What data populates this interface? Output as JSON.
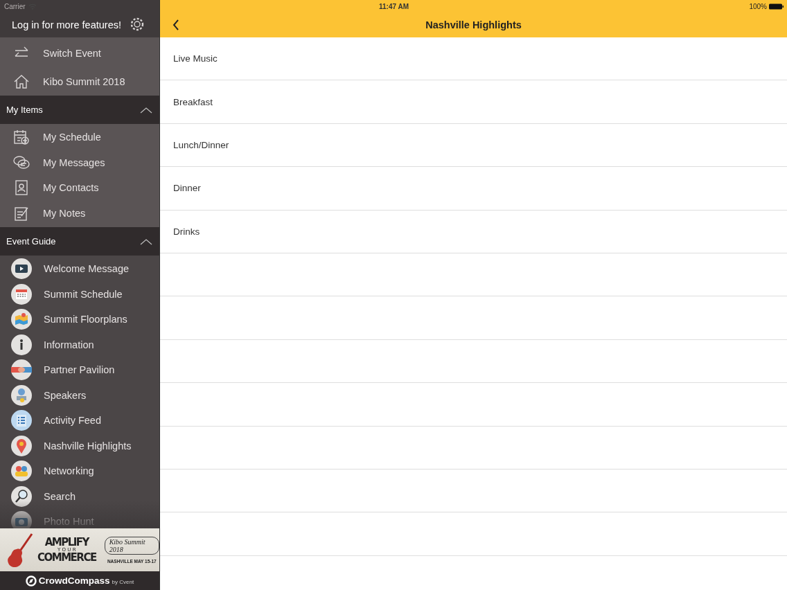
{
  "status_bar": {
    "carrier": "Carrier",
    "time": "11:47 AM",
    "battery": "100%"
  },
  "sidebar": {
    "login_text": "Log in for more features!",
    "top_items": [
      {
        "label": "Switch Event"
      },
      {
        "label": "Kibo Summit 2018"
      }
    ],
    "sections": [
      {
        "title": "My Items",
        "expanded": true,
        "items": [
          {
            "label": "My Schedule"
          },
          {
            "label": "My Messages"
          },
          {
            "label": "My Contacts"
          },
          {
            "label": "My Notes"
          }
        ]
      },
      {
        "title": "Event Guide",
        "expanded": true,
        "items": [
          {
            "label": "Welcome Message"
          },
          {
            "label": "Summit Schedule"
          },
          {
            "label": "Summit Floorplans"
          },
          {
            "label": "Information"
          },
          {
            "label": "Partner Pavilion"
          },
          {
            "label": "Speakers"
          },
          {
            "label": "Activity Feed"
          },
          {
            "label": "Nashville Highlights"
          },
          {
            "label": "Networking"
          },
          {
            "label": "Search"
          },
          {
            "label": "Photo Hunt"
          }
        ]
      }
    ],
    "banner": {
      "headline": "AMPLIFY",
      "middle": "Y O U R",
      "bottom": "COMMERCE",
      "event": "Kibo Summit 2018",
      "place": "NASHVILLE MAY 15-17"
    },
    "footer": {
      "brand": "CrowdCompass",
      "by": "by Cvent"
    }
  },
  "header": {
    "title": "Nashville Highlights"
  },
  "list": {
    "rows": [
      {
        "label": "Live Music"
      },
      {
        "label": "Breakfast"
      },
      {
        "label": "Lunch/Dinner"
      },
      {
        "label": "Dinner"
      },
      {
        "label": "Drinks"
      }
    ]
  }
}
